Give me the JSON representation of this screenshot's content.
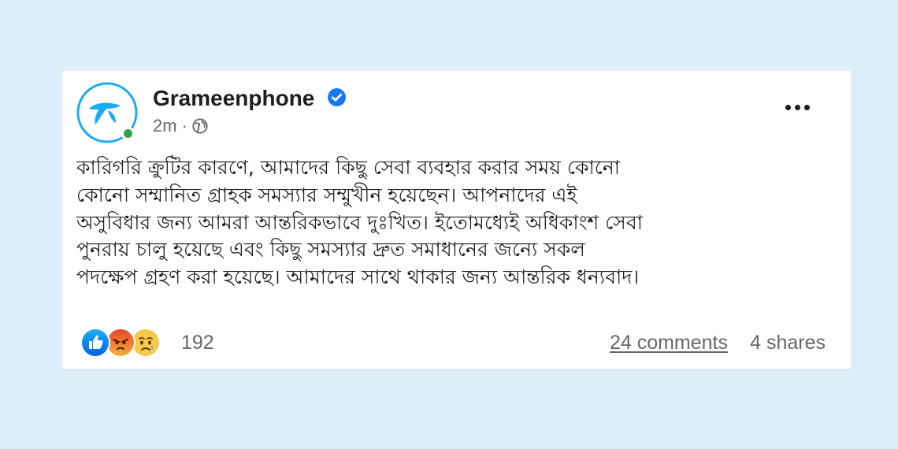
{
  "post": {
    "author": "Grameenphone",
    "verified": true,
    "time": "2m",
    "separator": "·",
    "audience_icon": "globe-icon",
    "more_icon": "more-horizontal-icon",
    "text_lines": [
      "কারিগরি ক্রুটির কারণে, আমাদের কিছু সেবা ব্যবহার করার সময় কোনো",
      "কোনো সম্মানিত গ্রাহক সমস্যার সম্মুখীন হয়েছেন। আপনাদের এই",
      "অসুবিধার জন্য আমরা আন্তরিকভাবে দুঃখিত। ইতোমধ্যেই অধিকাংশ সেবা",
      "পুনরায় চালু হয়েছে এবং কিছু সমস্যার দ্রুত সমাধানের জন্যে সকল",
      "পদক্ষেপ গ্রহণ করা হয়েছে। আমাদের সাথে থাকার জন্য আন্তরিক ধন্যবাদ।"
    ]
  },
  "engagement": {
    "reactions": [
      "like-icon",
      "angry-icon",
      "sad-icon"
    ],
    "reaction_count": "192",
    "comments": "24 comments",
    "shares": "4 shares"
  },
  "colors": {
    "background": "#dbeefa",
    "card": "#ffffff",
    "brand_blue": "#19aaf8",
    "verified_blue": "#1877f2",
    "online_green": "#31a24c",
    "secondary_text": "#65676b"
  }
}
